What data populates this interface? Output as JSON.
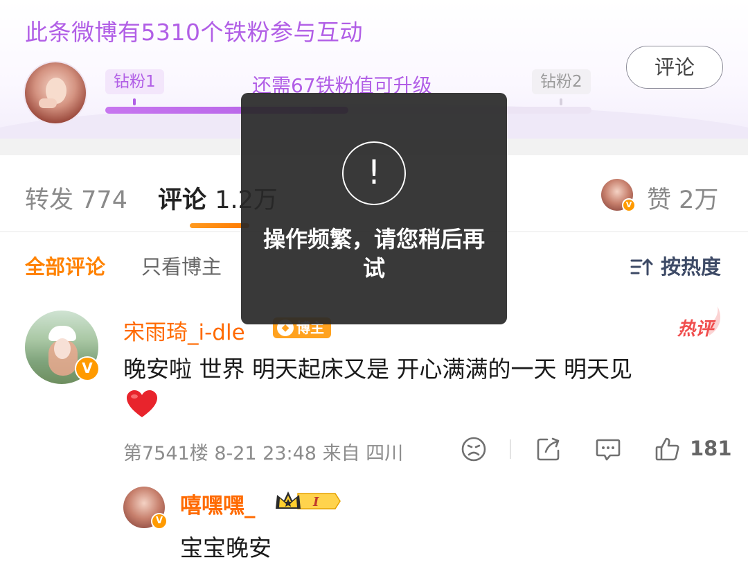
{
  "fan_banner": {
    "title": "此条微博有5310个铁粉参与互动",
    "current_level": "钻粉1",
    "next_level": "钻粉2",
    "upgrade_hint": "还需67铁粉值可升级",
    "progress": 0.5,
    "comment_button": "评论"
  },
  "tabs": {
    "repost_label": "转发",
    "repost_count": "774",
    "comment_label": "评论",
    "comment_count": "1.2万",
    "like_label": "赞",
    "like_count": "2万"
  },
  "filters": {
    "all": "全部评论",
    "op_only": "只看博主",
    "sort": "按热度"
  },
  "comment": {
    "author": "宋雨琦_i-dle",
    "host_badge": "博主",
    "hot_tag": "热评",
    "text": "晚安啦 世界 明天起床又是 开心满满的一天 明天见",
    "floor": "第7541楼",
    "time": "8-21 23:48",
    "location": "来自 四川",
    "likes": "181"
  },
  "reply": {
    "author": "嘻嘿嘿_",
    "text": "宝宝晚安"
  },
  "toast": {
    "icon": "!",
    "message": "操作频繁，请您稍后再试"
  },
  "colors": {
    "fan_purple": "#b15ee6",
    "accent_orange": "#ff8200",
    "name_orange": "#ff6a00",
    "hot_red": "#f04e4e",
    "toast_bg": "#282828"
  }
}
